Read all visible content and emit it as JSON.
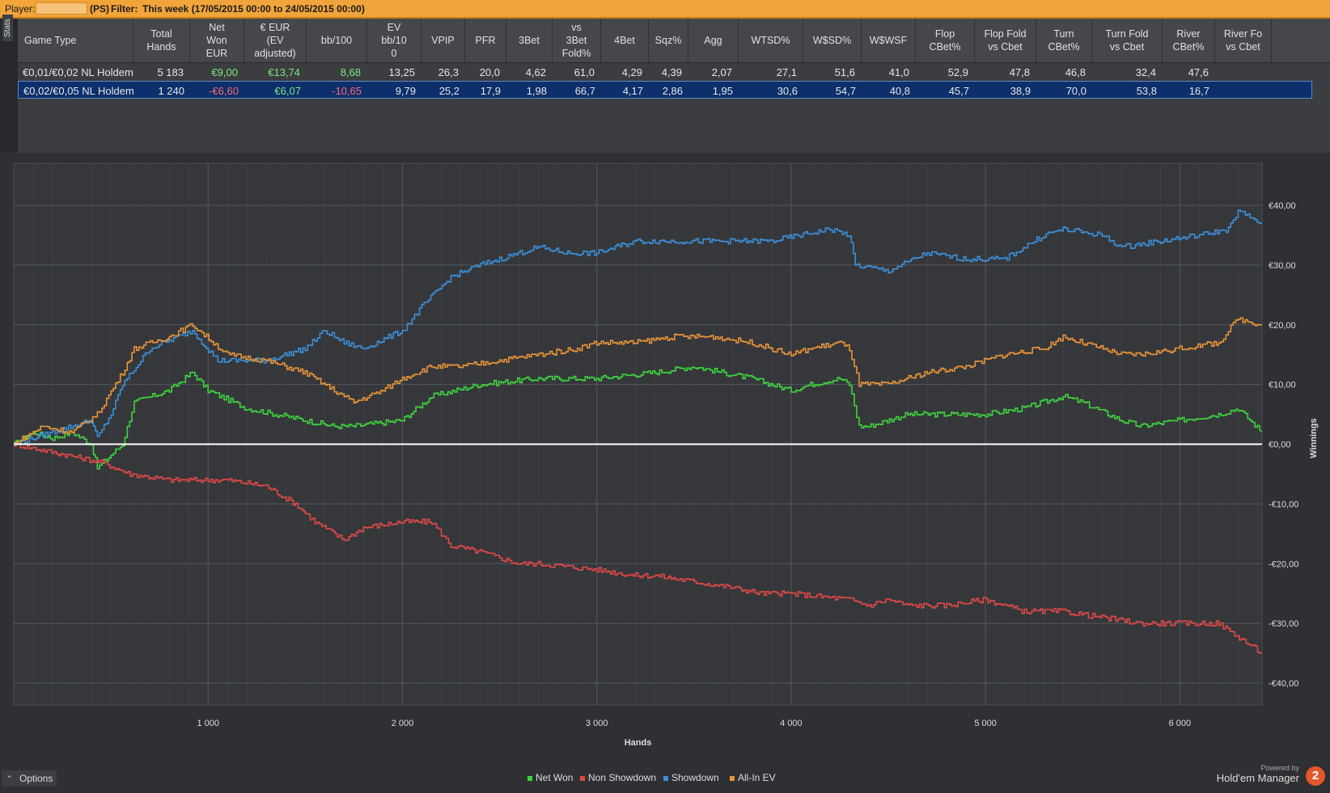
{
  "topbar": {
    "player_label": "Player:",
    "site": "(PS)",
    "filter_label": "Filter:",
    "filter_value": "This week (17/05/2015 00:00 to 24/05/2015 00:00)"
  },
  "sidebar": {
    "stats_tab": "Stats"
  },
  "table": {
    "columns": [
      {
        "label": "Game Type"
      },
      {
        "label": "Total\nHands"
      },
      {
        "label": "Net\nWon\nEUR"
      },
      {
        "label": "€ EUR\n(EV\nadjusted)"
      },
      {
        "label": "bb/100"
      },
      {
        "label": "EV\nbb/10\n0"
      },
      {
        "label": "VPIP"
      },
      {
        "label": "PFR"
      },
      {
        "label": "3Bet"
      },
      {
        "label": "vs\n3Bet\nFold%"
      },
      {
        "label": "4Bet"
      },
      {
        "label": "Sqz%"
      },
      {
        "label": "Agg"
      },
      {
        "label": "WTSD%"
      },
      {
        "label": "W$SD%"
      },
      {
        "label": "W$WSF"
      },
      {
        "label": "Flop\nCBet%"
      },
      {
        "label": "Flop Fold\nvs Cbet"
      },
      {
        "label": "Turn\nCBet%"
      },
      {
        "label": "Turn Fold\nvs Cbet"
      },
      {
        "label": "River\nCBet%"
      },
      {
        "label": "River Fo\nvs Cbet"
      }
    ],
    "rows": [
      {
        "cells": [
          "€0,01/€0,02 NL Holdem",
          "5 183",
          "€9,00",
          "€13,74",
          "8,68",
          "13,25",
          "26,3",
          "20,0",
          "4,62",
          "61,0",
          "4,29",
          "4,39",
          "2,07",
          "27,1",
          "51,6",
          "41,0",
          "52,9",
          "47,8",
          "46,8",
          "32,4",
          "47,6",
          ""
        ]
      },
      {
        "cells": [
          "€0,02/€0,05 NL Holdem",
          "1 240",
          "-€6,60",
          "€6,07",
          "-10,65",
          "9,79",
          "25,2",
          "17,9",
          "1,98",
          "66,7",
          "4,17",
          "2,86",
          "1,95",
          "30,6",
          "54,7",
          "40,8",
          "45,7",
          "38,9",
          "70,0",
          "53,8",
          "16,7",
          ""
        ]
      }
    ]
  },
  "chart_data": {
    "type": "line",
    "xlabel": "Hands",
    "ylabel": "Winnings",
    "xlim": [
      0,
      6423
    ],
    "ylim": [
      -40,
      40
    ],
    "x_ticks": [
      "1 000",
      "2 000",
      "3 000",
      "4 000",
      "5 000",
      "6 000"
    ],
    "y_ticks": [
      "€40,00",
      "€30,00",
      "€20,00",
      "€10,00",
      "€0,00",
      "-€10,00",
      "-€20,00",
      "-€30,00",
      "-€40,00"
    ],
    "grid": true,
    "legend_placement": "bottom-center",
    "series": [
      {
        "name": "Net Won",
        "color": "#3fd43f",
        "x": [
          0,
          100,
          200,
          300,
          400,
          430,
          560,
          620,
          800,
          920,
          1000,
          1200,
          1500,
          1650,
          1750,
          2000,
          2150,
          2400,
          2700,
          3000,
          3300,
          3500,
          3800,
          4000,
          4100,
          4250,
          4300,
          4350,
          4400,
          4600,
          4800,
          5000,
          5200,
          5400,
          5500,
          5700,
          5800,
          6000,
          6200,
          6300,
          6423
        ],
        "y": [
          0,
          2,
          1,
          2,
          0,
          -4,
          0,
          7,
          9,
          12,
          9,
          6,
          4,
          3,
          3,
          4,
          8,
          10,
          11,
          11,
          12,
          13,
          11,
          9,
          10,
          11,
          10,
          3,
          3,
          5,
          5,
          5,
          6,
          8,
          7,
          4,
          3,
          4,
          5,
          6,
          2
        ]
      },
      {
        "name": "Non Showdown",
        "color": "#e04848",
        "x": [
          0,
          150,
          300,
          450,
          600,
          800,
          1000,
          1100,
          1300,
          1450,
          1550,
          1700,
          1800,
          2000,
          2150,
          2250,
          2400,
          2500,
          2600,
          2700,
          3000,
          3200,
          3300,
          3500,
          3700,
          3850,
          4000,
          4300,
          4400,
          4500,
          4600,
          4800,
          5000,
          5200,
          5400,
          5600,
          5800,
          6000,
          6200,
          6423
        ],
        "y": [
          0,
          -1,
          -2,
          -3,
          -5,
          -6,
          -6,
          -6,
          -7,
          -10,
          -13,
          -16,
          -14,
          -13,
          -13,
          -17,
          -18,
          -19,
          -20,
          -20,
          -21,
          -22,
          -22,
          -23,
          -24,
          -25,
          -25,
          -26,
          -27,
          -26,
          -27,
          -27,
          -26,
          -28,
          -28,
          -29,
          -30,
          -30,
          -30,
          -35
        ]
      },
      {
        "name": "Showdown",
        "color": "#3d8fd8",
        "x": [
          0,
          200,
          400,
          430,
          500,
          560,
          700,
          920,
          1050,
          1300,
          1500,
          1600,
          1700,
          1800,
          2000,
          2100,
          2250,
          2400,
          2500,
          2700,
          2850,
          3000,
          3200,
          3300,
          3500,
          3700,
          3900,
          4050,
          4200,
          4300,
          4330,
          4500,
          4700,
          4900,
          5100,
          5300,
          5400,
          5600,
          5700,
          5900,
          6100,
          6250,
          6300,
          6423
        ],
        "y": [
          0,
          2,
          4,
          1,
          5,
          10,
          16,
          19,
          14,
          14,
          16,
          19,
          17,
          16,
          19,
          23,
          28,
          30,
          31,
          33,
          32,
          32,
          34,
          34,
          34,
          34,
          34,
          35,
          36,
          35,
          30,
          29,
          32,
          31,
          31,
          35,
          36,
          35,
          33,
          34,
          35,
          36,
          39,
          37
        ]
      },
      {
        "name": "All-In EV",
        "color": "#e8943a",
        "x": [
          0,
          150,
          300,
          430,
          560,
          620,
          800,
          920,
          1100,
          1300,
          1500,
          1650,
          1750,
          1900,
          2000,
          2150,
          2300,
          2500,
          2700,
          2900,
          3000,
          3200,
          3400,
          3600,
          3800,
          4000,
          4100,
          4250,
          4300,
          4350,
          4500,
          4700,
          4900,
          5100,
          5300,
          5400,
          5500,
          5700,
          5800,
          6000,
          6200,
          6300,
          6423
        ],
        "y": [
          0,
          3,
          2,
          5,
          12,
          16,
          18,
          20,
          15,
          14,
          12,
          9,
          7,
          9,
          11,
          13,
          13,
          14,
          15,
          16,
          17,
          17,
          18,
          18,
          17,
          15,
          16,
          17,
          16,
          10,
          10,
          12,
          13,
          15,
          16,
          18,
          17,
          15,
          15,
          16,
          17,
          21,
          20
        ]
      }
    ]
  },
  "options": {
    "label": "Options"
  },
  "legend": {
    "items": [
      "Net Won",
      "Non Showdown",
      "Showdown",
      "All-In EV"
    ]
  },
  "brand": {
    "powered_by": "Powered by",
    "name": "Hold'em Manager",
    "logo_digit": "2"
  }
}
